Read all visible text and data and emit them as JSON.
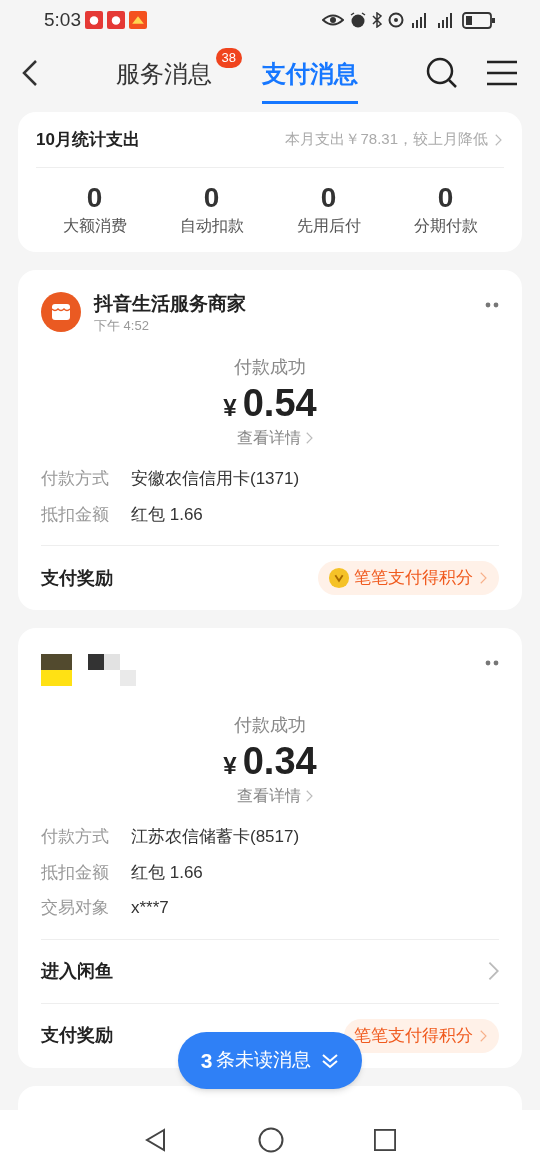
{
  "status_bar": {
    "time": "5:03"
  },
  "header": {
    "tabs": [
      {
        "label": "服务消息",
        "badge": "38",
        "selected": false
      },
      {
        "label": "支付消息",
        "selected": true
      }
    ]
  },
  "summary": {
    "title": "10月统计支出",
    "note": "本月支出￥78.31，较上月降低",
    "stats": [
      {
        "value": "0",
        "label": "大额消费"
      },
      {
        "value": "0",
        "label": "自动扣款"
      },
      {
        "value": "0",
        "label": "先用后付"
      },
      {
        "value": "0",
        "label": "分期付款"
      }
    ]
  },
  "messages": [
    {
      "avatar": {
        "kind": "shop"
      },
      "merchant": "抖音生活服务商家",
      "time": "下午 4:52",
      "status": "付款成功",
      "currency": "¥",
      "amount": "0.54",
      "details_link": "查看详情",
      "rows": [
        {
          "label": "付款方式",
          "value": "安徽农信信用卡(1371)"
        },
        {
          "label": "抵扣金额",
          "value": "红包 1.66"
        }
      ],
      "reward": {
        "label": "支付奖励",
        "badge": "笔笔支付得积分",
        "coin_visible": true
      }
    },
    {
      "avatar": {
        "kind": "mosaic"
      },
      "status": "付款成功",
      "currency": "¥",
      "amount": "0.34",
      "details_link": "查看详情",
      "rows": [
        {
          "label": "付款方式",
          "value": "江苏农信储蓄卡(8517)"
        },
        {
          "label": "抵扣金额",
          "value": "红包 1.66"
        },
        {
          "label": "交易对象",
          "value": "x***7"
        }
      ],
      "links": [
        {
          "label": "进入闲鱼"
        }
      ],
      "reward": {
        "label": "支付奖励",
        "badge": "笔笔支付得积分",
        "coin_visible": false
      }
    }
  ],
  "unread_button": {
    "count": "3",
    "label": "条未读消息"
  }
}
